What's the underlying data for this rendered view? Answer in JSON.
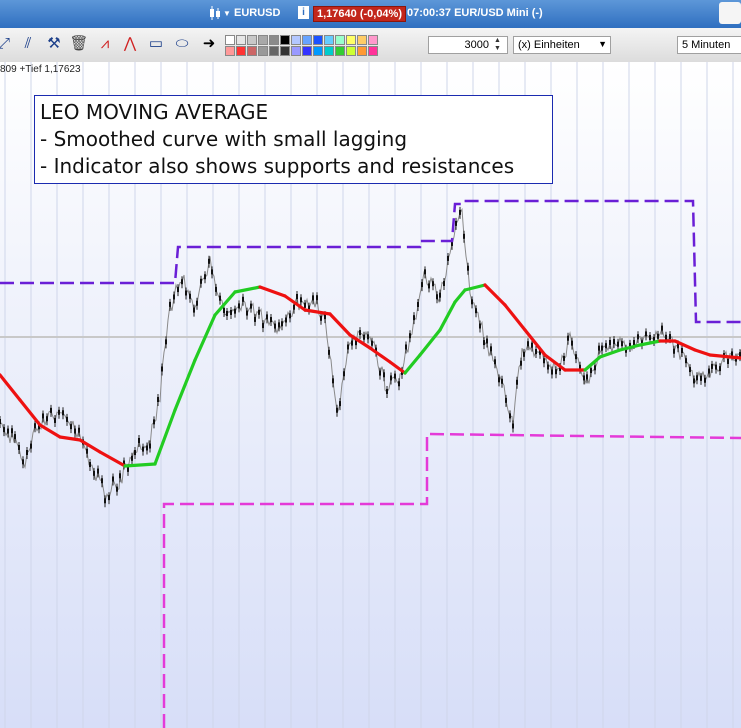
{
  "titlebar": {
    "ticker": "EURUSD",
    "price_change": "1,17640 (-0,04%)",
    "time_instrument": "07:00:37 EUR/USD Mini (-)"
  },
  "toolbar": {
    "tools": [
      "cursor-icon",
      "line-tool-icon",
      "hammer-icon",
      "trash-icon",
      "trend-icon",
      "fan-icon",
      "rectangle-icon",
      "ellipse-icon",
      "arrow-icon"
    ],
    "colors_top": [
      "#ffffff",
      "#e6e6e6",
      "#c8c8c8",
      "#a8a8a8",
      "#8a8a8a",
      "#000000",
      "#b3c7ff",
      "#66a3ff",
      "#1a52ff",
      "#66ccff",
      "#99ffcc",
      "#ffff66",
      "#ffcc66",
      "#ff99cc"
    ],
    "colors_bottom": [
      "#ff9999",
      "#ff3333",
      "#cc6666",
      "#999999",
      "#666666",
      "#333333",
      "#9999ff",
      "#3333ff",
      "#0099ff",
      "#00cccc",
      "#33cc33",
      "#ccff33",
      "#ff9933",
      "#ff3399"
    ],
    "quantity": "3000",
    "unit_select": "(x) Einheiten",
    "timeframe_select": "5 Minuten"
  },
  "chart": {
    "info": "809 +Tief 1,17623",
    "annotation": [
      "LEO MOVING AVERAGE",
      "- Smoothed curve with small lagging",
      "- Indicator also shows supports and resistances"
    ],
    "colors": {
      "ma_down": "#ee1111",
      "ma_up": "#22cc22",
      "resistance": "#6a1fd6",
      "support": "#e43ad8"
    }
  }
}
